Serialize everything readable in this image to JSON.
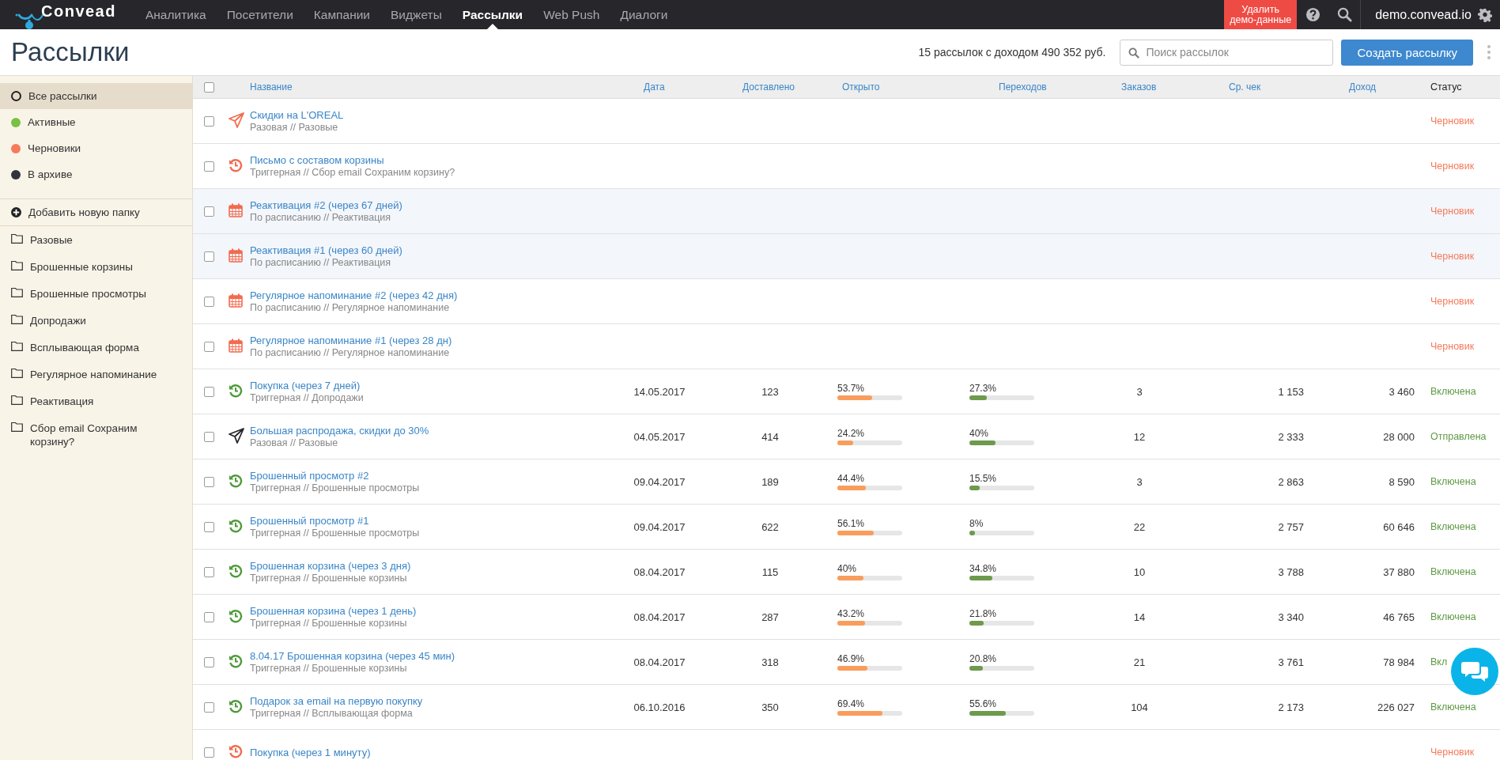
{
  "topbar": {
    "logo": "Convead",
    "nav": [
      {
        "label": "Аналитика",
        "selected": false
      },
      {
        "label": "Посетители",
        "selected": false
      },
      {
        "label": "Кампании",
        "selected": false
      },
      {
        "label": "Виджеты",
        "selected": false
      },
      {
        "label": "Рассылки",
        "selected": true
      },
      {
        "label": "Web Push",
        "selected": false
      },
      {
        "label": "Диалоги",
        "selected": false
      }
    ],
    "demo_button": "Удалить демо-данные",
    "account": "demo.convead.io"
  },
  "header": {
    "title": "Рассылки",
    "summary": "15 рассылок с доходом 490 352 руб.",
    "search": {
      "placeholder": "Поиск рассылок"
    },
    "create_button": "Создать рассылку"
  },
  "sidebar": {
    "filters": [
      {
        "label": "Все рассылки",
        "kind": "all",
        "selected": true
      },
      {
        "label": "Активные",
        "kind": "dot",
        "color": "#7ac143",
        "selected": false
      },
      {
        "label": "Черновики",
        "kind": "dot",
        "color": "#f77a5c",
        "selected": false
      },
      {
        "label": "В архиве",
        "kind": "dot",
        "color": "#32343d",
        "selected": false
      }
    ],
    "add_folder": "Добавить новую папку",
    "folders": [
      "Разовые",
      "Брошенные корзины",
      "Брошенные просмотры",
      "Допродажи",
      "Всплывающая форма",
      "Регулярное напоминание",
      "Реактивация",
      "Сбор email Сохраним корзину?"
    ]
  },
  "table": {
    "columns": [
      "Название",
      "Дата",
      "Доставлено",
      "Открыто",
      "Переходов",
      "Заказов",
      "Ср. чек",
      "Доход",
      "Статус"
    ],
    "header_checked": false,
    "rows": [
      {
        "kind": "plane",
        "name": "Скидки на L'OREAL",
        "subtitle": "Разовая // Разовые",
        "status": {
          "label": "Черновик",
          "kind": "draft"
        },
        "checked": false,
        "highlighted": false
      },
      {
        "kind": "trigger",
        "name": "Письмо с составом корзины",
        "subtitle": "Триггерная // Сбор email Сохраним корзину?",
        "status": {
          "label": "Черновик",
          "kind": "draft"
        },
        "checked": false,
        "highlighted": false
      },
      {
        "kind": "calendar",
        "name": "Реактивация #2 (через 67 дней)",
        "subtitle": "По расписанию // Реактивация",
        "status": {
          "label": "Черновик",
          "kind": "draft"
        },
        "checked": false,
        "highlighted": true
      },
      {
        "kind": "calendar",
        "name": "Реактивация #1 (через 60 дней)",
        "subtitle": "По расписанию // Реактивация",
        "status": {
          "label": "Черновик",
          "kind": "draft"
        },
        "checked": false,
        "highlighted": true
      },
      {
        "kind": "calendar",
        "name": "Регулярное напоминание #2 (через 42 дня)",
        "subtitle": "По расписанию // Регулярное напоминание",
        "status": {
          "label": "Черновик",
          "kind": "draft"
        },
        "checked": false,
        "highlighted": false
      },
      {
        "kind": "calendar",
        "name": "Регулярное напоминание #1 (через 28 дн)",
        "subtitle": "По расписанию // Регулярное напоминание",
        "status": {
          "label": "Черновик",
          "kind": "draft"
        },
        "checked": false,
        "highlighted": false
      },
      {
        "kind": "trigger",
        "name": "Покупка (через 7 дней)",
        "subtitle": "Триггерная // Допродажи",
        "date": "14.05.2017",
        "delivered": "123",
        "opened": {
          "text": "53.7%",
          "level": 0.537
        },
        "clicks": {
          "text": "27.3%",
          "level": 0.273
        },
        "orders": "3",
        "avg_check": "1 153",
        "revenue": "3 460",
        "status": {
          "label": "Включена",
          "kind": "on"
        },
        "checked": false,
        "highlighted": false
      },
      {
        "kind": "plane",
        "name": "Большая распродажа, скидки до 30%",
        "subtitle": "Разовая // Разовые",
        "date": "04.05.2017",
        "delivered": "414",
        "opened": {
          "text": "24.2%",
          "level": 0.242
        },
        "clicks": {
          "text": "40%",
          "level": 0.4
        },
        "orders": "12",
        "avg_check": "2 333",
        "revenue": "28 000",
        "status": {
          "label": "Отправлена",
          "kind": "sent"
        },
        "checked": false,
        "highlighted": false
      },
      {
        "kind": "trigger",
        "name": "Брошенный просмотр #2",
        "subtitle": "Триггерная // Брошенные просмотры",
        "date": "09.04.2017",
        "delivered": "189",
        "opened": {
          "text": "44.4%",
          "level": 0.444
        },
        "clicks": {
          "text": "15.5%",
          "level": 0.155
        },
        "orders": "3",
        "avg_check": "2 863",
        "revenue": "8 590",
        "status": {
          "label": "Включена",
          "kind": "on"
        },
        "checked": false,
        "highlighted": false
      },
      {
        "kind": "trigger",
        "name": "Брошенный просмотр #1",
        "subtitle": "Триггерная // Брошенные просмотры",
        "date": "09.04.2017",
        "delivered": "622",
        "opened": {
          "text": "56.1%",
          "level": 0.561
        },
        "clicks": {
          "text": "8%",
          "level": 0.08
        },
        "orders": "22",
        "avg_check": "2 757",
        "revenue": "60 646",
        "status": {
          "label": "Включена",
          "kind": "on"
        },
        "checked": false,
        "highlighted": false
      },
      {
        "kind": "trigger",
        "name": "Брошенная корзина (через 3 дня)",
        "subtitle": "Триггерная // Брошенные корзины",
        "date": "08.04.2017",
        "delivered": "115",
        "opened": {
          "text": "40%",
          "level": 0.4
        },
        "clicks": {
          "text": "34.8%",
          "level": 0.348
        },
        "orders": "10",
        "avg_check": "3 788",
        "revenue": "37 880",
        "status": {
          "label": "Включена",
          "kind": "on"
        },
        "checked": false,
        "highlighted": false
      },
      {
        "kind": "trigger",
        "name": "Брошенная корзина (через 1 день)",
        "subtitle": "Триггерная // Брошенные корзины",
        "date": "08.04.2017",
        "delivered": "287",
        "opened": {
          "text": "43.2%",
          "level": 0.432
        },
        "clicks": {
          "text": "21.8%",
          "level": 0.218
        },
        "orders": "14",
        "avg_check": "3 340",
        "revenue": "46 765",
        "status": {
          "label": "Включена",
          "kind": "on"
        },
        "checked": false,
        "highlighted": false
      },
      {
        "kind": "trigger",
        "name": "8.04.17 Брошенная корзина (через 45 мин)",
        "subtitle": "Триггерная // Брошенные корзины",
        "date": "08.04.2017",
        "delivered": "318",
        "opened": {
          "text": "46.9%",
          "level": 0.469
        },
        "clicks": {
          "text": "20.8%",
          "level": 0.208
        },
        "orders": "21",
        "avg_check": "3 761",
        "revenue": "78 984",
        "status": {
          "label": "Вкл",
          "kind": "on"
        },
        "checked": false,
        "highlighted": false
      },
      {
        "kind": "trigger",
        "name": "Подарок за email на первую покупку",
        "subtitle": "Триггерная // Всплывающая форма",
        "date": "06.10.2016",
        "delivered": "350",
        "opened": {
          "text": "69.4%",
          "level": 0.694
        },
        "clicks": {
          "text": "55.6%",
          "level": 0.556
        },
        "orders": "104",
        "avg_check": "2 173",
        "revenue": "226 027",
        "status": {
          "label": "Включена",
          "kind": "on"
        },
        "checked": false,
        "highlighted": false
      },
      {
        "kind": "trigger",
        "name": "Покупка (через 1 минуту)",
        "status": {
          "label": "Черновик",
          "kind": "draft"
        },
        "checked": false,
        "highlighted": false
      }
    ]
  }
}
